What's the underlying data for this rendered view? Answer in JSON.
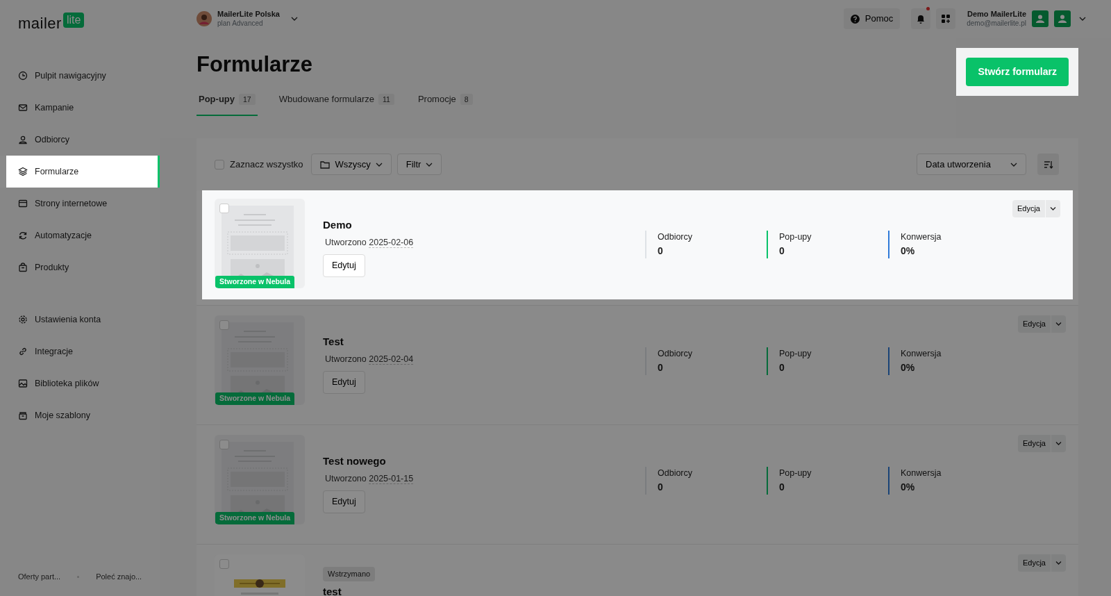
{
  "brand": {
    "word": "mailer",
    "badge": "lite"
  },
  "sidebar": {
    "groups": [
      [
        {
          "label": "Pulpit nawigacyjny",
          "selected": false
        },
        {
          "label": "Kampanie",
          "selected": false
        },
        {
          "label": "Odbiorcy",
          "selected": false
        },
        {
          "label": "Formularze",
          "selected": true
        },
        {
          "label": "Strony internetowe",
          "selected": false
        },
        {
          "label": "Automatyzacje",
          "selected": false
        },
        {
          "label": "Produkty",
          "selected": false
        }
      ],
      [
        {
          "label": "Ustawienia konta",
          "selected": false
        },
        {
          "label": "Integracje",
          "selected": false
        },
        {
          "label": "Biblioteka plików",
          "selected": false
        },
        {
          "label": "Moje szablony",
          "selected": false
        }
      ]
    ],
    "footer": [
      "Oferty part...",
      "Poleć znajo..."
    ]
  },
  "topbar": {
    "account": {
      "name": "MailerLite Polska",
      "plan": "plan Advanced"
    },
    "help": "Pomoc",
    "notifications_unread": true,
    "user": {
      "name": "Demo MailerLite",
      "email": "demo@mailerlite.pl"
    }
  },
  "page": {
    "title": "Formularze",
    "create_button": {
      "label": "Stwórz formularz",
      "highlighted": true
    }
  },
  "tabs": [
    {
      "label": "Pop-upy",
      "count": "17",
      "selected": true
    },
    {
      "label": "Wbudowane formularze",
      "count": "11",
      "selected": false
    },
    {
      "label": "Promocje",
      "count": "8",
      "selected": false
    }
  ],
  "toolbar": {
    "select_all": {
      "label": "Zaznacz wszystko",
      "checked": false
    },
    "folder": "Wszyscy",
    "filter": "Filtr",
    "sort": "Data utworzenia"
  },
  "forms": [
    {
      "title": "Demo",
      "created": "Utworzono",
      "date": "2025-02-06",
      "edit": "Edytuj",
      "badge": "Stworzone w Nebula",
      "kind": "template",
      "highlighted": true,
      "action": "Edycja",
      "stats": [
        {
          "label": "Odbiorcy",
          "value": "0"
        },
        {
          "label": "Pop-upy",
          "value": "0"
        },
        {
          "label": "Konwersja",
          "value": "0%"
        }
      ]
    },
    {
      "title": "Test",
      "created": "Utworzono",
      "date": "2025-02-04",
      "edit": "Edytuj",
      "badge": "Stworzone w Nebula",
      "kind": "template",
      "highlighted": false,
      "action": "Edycja",
      "stats": [
        {
          "label": "Odbiorcy",
          "value": "0"
        },
        {
          "label": "Pop-upy",
          "value": "0"
        },
        {
          "label": "Konwersja",
          "value": "0%"
        }
      ]
    },
    {
      "title": "Test nowego",
      "created": "Utworzono",
      "date": "2025-01-15",
      "edit": "Edytuj",
      "badge": "Stworzone w Nebula",
      "kind": "template",
      "highlighted": false,
      "action": "Edycja",
      "stats": [
        {
          "label": "Odbiorcy",
          "value": "0"
        },
        {
          "label": "Pop-upy",
          "value": "0"
        },
        {
          "label": "Konwersja",
          "value": "0%"
        }
      ]
    },
    {
      "title": "test",
      "status": "Wstrzymano",
      "kind": "picture",
      "highlighted": false,
      "action": "Edycja"
    }
  ]
}
